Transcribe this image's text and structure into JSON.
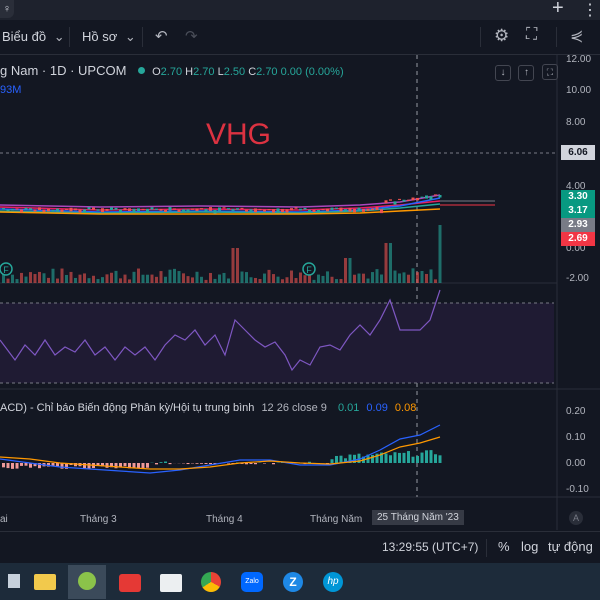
{
  "tabbar": {
    "plus": "+",
    "menu": "⋮"
  },
  "toolbar": {
    "chart_menu": "Biểu đồ",
    "profile_menu": "Hồ sơ",
    "chev": "⌄"
  },
  "legend": {
    "symbol": "g Nam · 1D · UPCOM",
    "o_label": "O",
    "o_value": "2.70",
    "h_label": "H",
    "h_value": "2.70",
    "l_label": "L",
    "l_value": "2.50",
    "c_label": "C",
    "c_value": "2.70",
    "change": "0.00 (0.00%)",
    "volume": "93M"
  },
  "watermark": "VHG",
  "price_axis": [
    "12.00",
    "10.00",
    "8.00",
    "6.06",
    "4.00",
    "0.00",
    "-2.00"
  ],
  "price_tags": [
    {
      "text": "3.30",
      "color": "#089981"
    },
    {
      "text": "3.17",
      "color": "#089981"
    },
    {
      "text": "2.93",
      "color": "#787b86"
    },
    {
      "text": "2.69",
      "color": "#f23645"
    }
  ],
  "macd": {
    "title": "ACD) - Chỉ báo Biến động Phân kỳ/Hội tụ trung bình",
    "params": "12 26 close 9",
    "v1": "0.01",
    "v2": "0.09",
    "v3": "0.08",
    "axis": [
      "0.20",
      "0.10",
      "0.00",
      "-0.10"
    ]
  },
  "time_axis": {
    "labels": [
      "ai",
      "Tháng 3",
      "Tháng 4",
      "Tháng Năm"
    ],
    "current": "25 Tháng Năm '23",
    "auto": "A"
  },
  "status": {
    "time": "13:29:55 (UTC+7)",
    "percent": "%",
    "log": "log",
    "auto": "tự động"
  },
  "markers": [
    "F",
    "F"
  ],
  "colors": {
    "up": "#26a69a",
    "down": "#ef5350",
    "rsi": "#7e57c2",
    "macd": "#2962ff",
    "signal": "#ff9800",
    "bg": "#131722"
  }
}
